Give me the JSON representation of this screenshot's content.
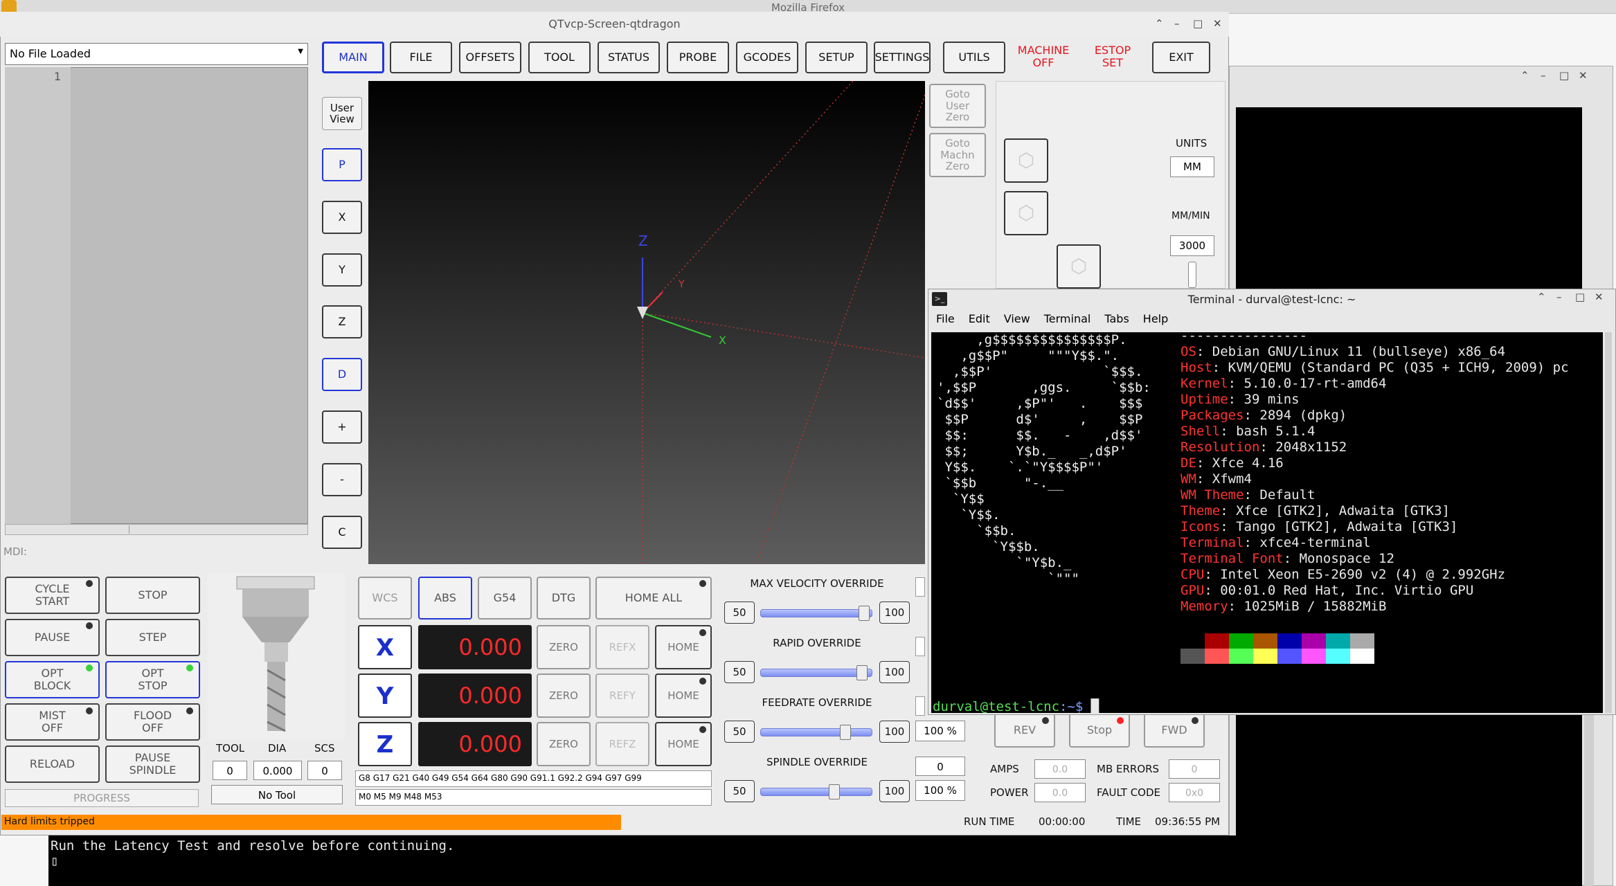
{
  "firefox": {
    "title": "Mozilla Firefox"
  },
  "qtdragon": {
    "title": "QTvcp-Screen-qtdragon",
    "file_select": "No File Loaded",
    "gcode_line_number": "1",
    "mdi_label": "MDI:",
    "tabs": [
      "MAIN",
      "FILE",
      "OFFSETS",
      "TOOL",
      "STATUS",
      "PROBE",
      "GCODES",
      "SETUP",
      "SETTINGS",
      "UTILS"
    ],
    "machine_state": "MACHINE\nOFF",
    "estop_state": "ESTOP\nSET",
    "exit_label": "EXIT",
    "view_buttons": {
      "user_view": "User\nView",
      "p": "P",
      "x": "X",
      "y": "Y",
      "z": "Z",
      "d": "D",
      "plus": "+",
      "minus": "-",
      "c": "C"
    },
    "goto_user_zero": "Goto\nUser\nZero",
    "goto_machine_zero": "Goto\nMachn\nZero",
    "units_label": "UNITS",
    "units_value": "MM",
    "rate_label": "MM/MIN",
    "rate_value": "3000",
    "axis_labels_3d": {
      "z": "Z",
      "y": "Y",
      "x": "X"
    },
    "control_buttons": [
      {
        "label": "CYCLE\nSTART"
      },
      {
        "label": "STOP"
      },
      {
        "label": "PAUSE"
      },
      {
        "label": "STEP"
      },
      {
        "label": "OPT\nBLOCK"
      },
      {
        "label": "OPT\nSTOP"
      },
      {
        "label": "MIST\nOFF"
      },
      {
        "label": "FLOOD\nOFF"
      },
      {
        "label": "RELOAD"
      },
      {
        "label": "PAUSE\nSPINDLE"
      }
    ],
    "progress_label": "PROGRESS",
    "tool": {
      "tool_label": "TOOL",
      "dia_label": "DIA",
      "scs_label": "SCS",
      "tool_value": "0",
      "dia_value": "0.000",
      "scs_value": "0",
      "name": "No Tool"
    },
    "dro_header": {
      "wcs": "WCS",
      "abs": "ABS",
      "g54": "G54",
      "dtg": "DTG",
      "home_all": "HOME ALL"
    },
    "axes": [
      {
        "axis": "X",
        "value": "0.000",
        "zero": "ZERO",
        "ref": "REFX",
        "home": "HOME"
      },
      {
        "axis": "Y",
        "value": "0.000",
        "zero": "ZERO",
        "ref": "REFY",
        "home": "HOME"
      },
      {
        "axis": "Z",
        "value": "0.000",
        "zero": "ZERO",
        "ref": "REFZ",
        "home": "HOME"
      }
    ],
    "gcodes_active": "G8 G17 G21 G40 G49 G54 G64 G80 G90 G91.1 G92.2 G94 G97 G99",
    "mcodes_active": "M0 M5 M9 M48 M53",
    "overrides": [
      {
        "title": "MAX VELOCITY OVERRIDE",
        "min": "50",
        "max": "100",
        "value_pct": 100,
        "readout": ""
      },
      {
        "title": "RAPID OVERRIDE",
        "min": "50",
        "max": "100",
        "value_pct": 100,
        "readout": ""
      },
      {
        "title": "FEEDRATE OVERRIDE",
        "min": "50",
        "max": "100",
        "value_pct": 100,
        "readout": "100 %"
      },
      {
        "title": "SPINDLE OVERRIDE",
        "min": "50",
        "max": "100",
        "value_pct": 100,
        "readout": "100 %"
      }
    ],
    "spindle_rpm": "0",
    "spindle_buttons": {
      "rev": "REV",
      "stop": "Stop",
      "fwd": "FWD"
    },
    "amps_label": "AMPS",
    "amps_value": "0.0",
    "power_label": "POWER",
    "power_value": "0.0",
    "mb_errors_label": "MB ERRORS",
    "mb_errors_value": "0",
    "fault_code_label": "FAULT CODE",
    "fault_code_value": "0x0",
    "status_message": "Hard limits tripped",
    "run_time_label": "RUN TIME",
    "run_time_value": "00:00:00",
    "time_label": "TIME",
    "time_value": "09:36:55 PM"
  },
  "terminal": {
    "title": "Terminal - durval@test-lcnc: ~",
    "menu": [
      "File",
      "Edit",
      "View",
      "Terminal",
      "Tabs",
      "Help"
    ],
    "logo_lines": [
      "     ,g$$$$$$$$$$$$$$$P.",
      "   ,g$$P\"     \"\"\"Y$$.\".",
      "  ,$$P'              `$$$.",
      "',$$P       ,ggs.     `$$b:",
      "`d$$'     ,$P\"'   .    $$$",
      " $$P      d$'     ,    $$P",
      " $$:      $$.   -    ,d$$'",
      " $$;      Y$b._   _,d$P'",
      " Y$$.    `.`\"Y$$$$P\"'",
      " `$$b      \"-.__",
      "  `Y$$",
      "   `Y$$.",
      "     `$$b.",
      "       `Y$$b.",
      "          `\"Y$b._",
      "              `\"\"\""
    ],
    "separator": "----------------",
    "info": [
      {
        "key": "OS",
        "value": "Debian GNU/Linux 11 (bullseye) x86_64"
      },
      {
        "key": "Host",
        "value": "KVM/QEMU (Standard PC (Q35 + ICH9, 2009) pc"
      },
      {
        "key": "Kernel",
        "value": "5.10.0-17-rt-amd64"
      },
      {
        "key": "Uptime",
        "value": "39 mins"
      },
      {
        "key": "Packages",
        "value": "2894 (dpkg)"
      },
      {
        "key": "Shell",
        "value": "bash 5.1.4"
      },
      {
        "key": "Resolution",
        "value": "2048x1152"
      },
      {
        "key": "DE",
        "value": "Xfce 4.16"
      },
      {
        "key": "WM",
        "value": "Xfwm4"
      },
      {
        "key": "WM Theme",
        "value": "Default"
      },
      {
        "key": "Theme",
        "value": "Xfce [GTK2], Adwaita [GTK3]"
      },
      {
        "key": "Icons",
        "value": "Tango [GTK2], Adwaita [GTK3]"
      },
      {
        "key": "Terminal",
        "value": "xfce4-terminal"
      },
      {
        "key": "Terminal Font",
        "value": "Monospace 12"
      },
      {
        "key": "CPU",
        "value": "Intel Xeon E5-2690 v2 (4) @ 2.992GHz"
      },
      {
        "key": "GPU",
        "value": "00:01.0 Red Hat, Inc. Virtio GPU"
      },
      {
        "key": "Memory",
        "value": "1025MiB / 15882MiB"
      }
    ],
    "palette_dark": [
      "#000000",
      "#aa0000",
      "#00aa00",
      "#aa5500",
      "#0000aa",
      "#aa00aa",
      "#00aaaa",
      "#aaaaaa"
    ],
    "palette_bright": [
      "#555555",
      "#ff5555",
      "#55ff55",
      "#ffff55",
      "#5555ff",
      "#ff55ff",
      "#55ffff",
      "#ffffff"
    ],
    "prompt_user": "durval@test-lcnc",
    "prompt_path": ":~$"
  },
  "back_terminal": {
    "message": "Run the Latency Test and resolve before continuing."
  }
}
